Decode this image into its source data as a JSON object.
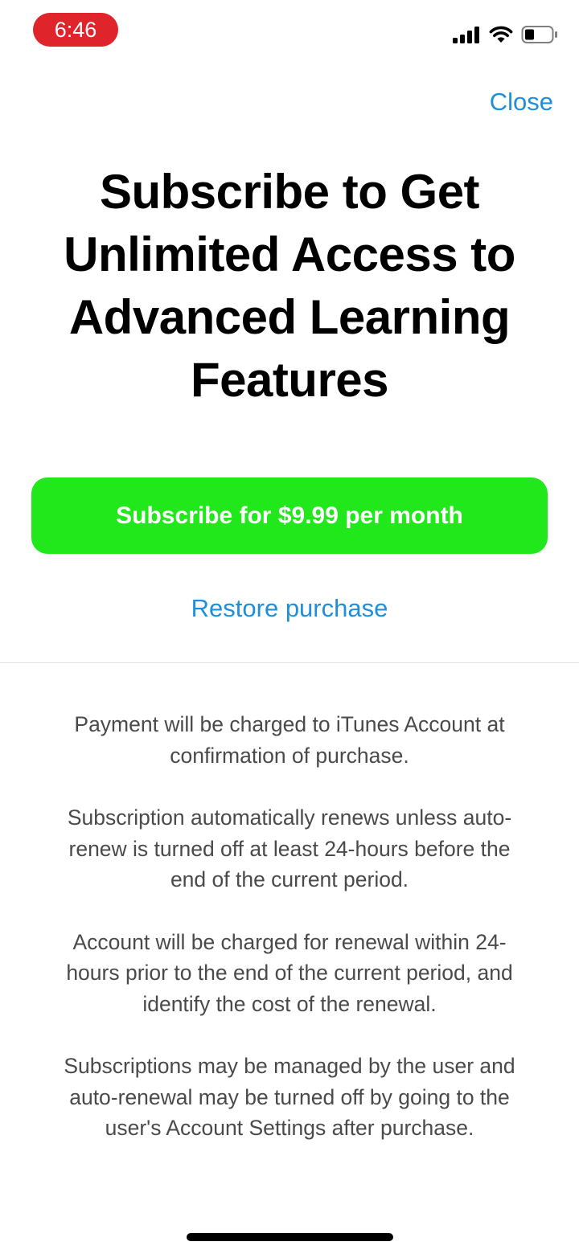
{
  "status_bar": {
    "time": "6:46",
    "icons": [
      "signal-icon",
      "wifi-icon",
      "battery-icon"
    ],
    "time_pill_color": "#e0242c"
  },
  "header": {
    "close_label": "Close"
  },
  "headline": "Subscribe to Get Unlimited Access to Advanced Learning Features",
  "subscribe_button": {
    "label": "Subscribe for $9.99 per month",
    "color": "#20e81a"
  },
  "restore_label": "Restore purchase",
  "link_color": "#1f8fdb",
  "terms": [
    "Payment will be charged to iTunes Account at confirmation of purchase.",
    "Subscription automatically renews unless auto-renew is turned off at least 24-hours before the end of the current period.",
    "Account will be charged for renewal within 24-hours prior to the end of the current period, and identify the cost of the renewal.",
    "Subscriptions may be managed by the user and auto-renewal may be turned off by going to the user's Account Settings after purchase."
  ]
}
